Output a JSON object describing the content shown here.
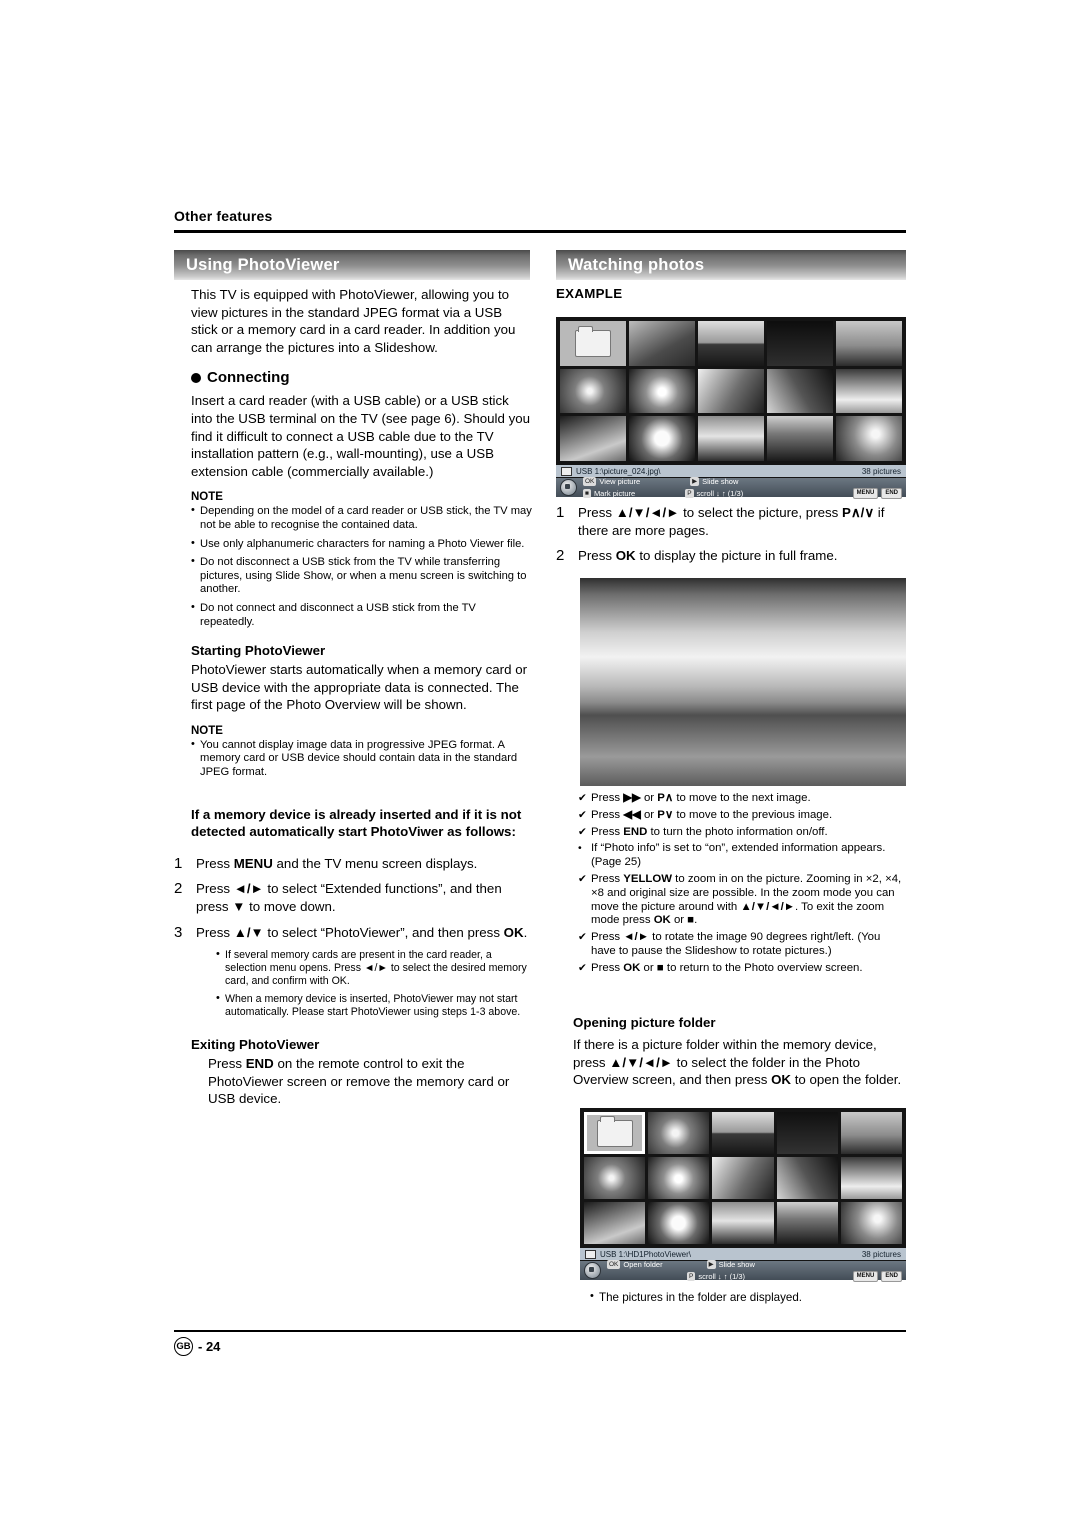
{
  "page": {
    "section_label": "Other features",
    "footer_region": "GB",
    "footer_page": "- 24"
  },
  "left_column": {
    "title": "Using PhotoViewer",
    "intro": "This TV is equipped with PhotoViewer, allowing you to view pictures in the standard JPEG format via a USB stick or a memory card in a card reader. In addition you can arrange the pictures into a Slideshow.",
    "connecting": {
      "heading": "Connecting",
      "body": "Insert a card reader (with a USB cable) or a USB stick into the USB terminal on the TV (see page 6). Should you find it difficult to connect a USB cable due to the TV installation pattern (e.g., wall-mounting), use a USB extension cable (commercially available.)",
      "note_label": "NOTE",
      "notes": [
        "Depending on the model of a card reader or USB stick, the TV may not be able to recognise the contained data.",
        "Use only alphanumeric characters for naming a Photo Viewer file.",
        "Do not disconnect a USB stick from the TV while transferring pictures, using Slide Show, or when a menu screen is switching to another.",
        "Do not connect and disconnect a USB stick from the TV repeatedly."
      ]
    },
    "starting": {
      "heading": "Starting PhotoViewer",
      "body": "PhotoViewer starts automatically when a memory card or USB device with the appropriate data is connected. The first page of the Photo Overview will be shown.",
      "note_label": "NOTE",
      "notes": [
        "You cannot display image data in progressive JPEG format. A memory card or USB device should contain data in the standard JPEG format."
      ]
    },
    "manual_start": {
      "heading": "If a memory device is already inserted and if it is not detected automatically start PhotoViwer as follows:",
      "steps": [
        {
          "num": "1",
          "text": "Press MENU and the TV menu screen displays."
        },
        {
          "num": "2",
          "text": "Press ◄/► to select “Extended functions”, and then press ▼ to move down."
        },
        {
          "num": "3",
          "text": "Press ▲/▼ to select “PhotoViewer”, and then press OK."
        }
      ],
      "notes": [
        "If several memory cards are present in the card reader, a selection menu opens. Press ◄/► to select the desired memory card, and confirm with OK.",
        "When a memory device is inserted, PhotoViewer may not start automatically. Please start PhotoViewer using steps 1-3 above."
      ]
    },
    "exiting": {
      "heading": "Exiting PhotoViewer",
      "body": "Press END on the remote control to exit the PhotoViewer screen or remove the memory card or USB device."
    }
  },
  "right_column": {
    "title": "Watching photos",
    "example_label": "EXAMPLE",
    "screen1": {
      "path": "USB 1:\\picture_024.jpg\\",
      "count": "38 pictures",
      "op_view": "View picture",
      "op_slide": "Slide show",
      "op_mark": "Mark picture",
      "op_scroll": "scroll ↓ ↑ (1/3)",
      "key_menu": "MENU",
      "key_end": "END"
    },
    "steps": [
      {
        "num": "1",
        "text": "Press ▲/▼/◄/► to select the picture, press P∧/∨ if there are more pages."
      },
      {
        "num": "2",
        "text": "Press OK to display the picture in full frame."
      }
    ],
    "checks": [
      "Press ►► or P∧ to move to the next image.",
      "Press ◄◄ or P∨ to move to the previous image.",
      "Press END to turn the photo information on/off.",
      "If “Photo info” is set to “on”, extended information appears. (Page 25)",
      "Press YELLOW to zoom in on the picture. Zooming in ×2, ×4, ×8 and original size are possible. In the zoom mode you can move the picture around with ▲/▼/◄/►. To exit the zoom mode press OK or ■.",
      "Press ◄/► to rotate the image 90 degrees right/left. (You have to pause the Slideshow to rotate pictures.)",
      "Press OK or ■ to return to the Photo overview screen."
    ],
    "check_marks": [
      "✔",
      "✔",
      "✔",
      "•",
      "✔",
      "✔",
      "✔"
    ],
    "opening_folder": {
      "heading": "Opening picture folder",
      "body": "If there is a picture folder within the memory device, press ▲/▼/◄/► to select the folder in the Photo Overview screen, and then press OK to open the folder."
    },
    "screen2": {
      "path": "USB 1:\\HD1PhotoViewer\\",
      "count": "38 pictures",
      "op_open": "Open folder",
      "op_slide": "Slide show",
      "op_scroll": "scroll ↓ ↑ (1/3)",
      "key_menu": "MENU",
      "key_end": "END"
    },
    "closing_note": "The pictures in the folder are displayed."
  }
}
